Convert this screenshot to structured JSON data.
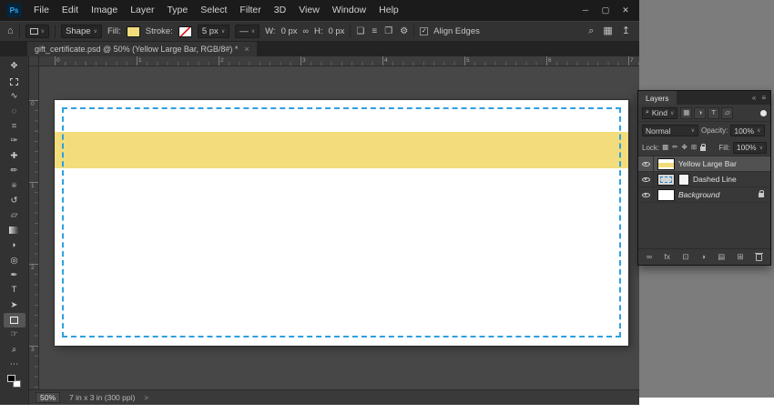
{
  "colors": {
    "fill_yellow": "#f2dc7c",
    "dashed_blue": "#2f9fe0",
    "accent_blue": "#37a7f0"
  },
  "menu_bar": {
    "logo": "Ps",
    "items": [
      "File",
      "Edit",
      "Image",
      "Layer",
      "Type",
      "Select",
      "Filter",
      "3D",
      "View",
      "Window",
      "Help"
    ],
    "window_controls": {
      "minimize": "─",
      "maximize": "▢",
      "close": "✕"
    }
  },
  "options_bar": {
    "home_icon_glyph": "⌂",
    "tool_preset_chevron": "∨",
    "mode_select": {
      "value": "Shape",
      "chevron": "∨"
    },
    "fill": {
      "label": "Fill:"
    },
    "stroke": {
      "label": "Stroke:"
    },
    "stroke_width": {
      "value": "5 px",
      "chevron": "∨"
    },
    "stroke_type": {
      "value": "—",
      "chevron": "∨"
    },
    "dims": {
      "w_label": "W:",
      "w_value": "0 px",
      "link_icon_glyph": "∞",
      "h_label": "H:",
      "h_value": "0 px"
    },
    "ops_icons": [
      {
        "name": "path-operations-icon",
        "glyph": "❏"
      },
      {
        "name": "path-alignment-icon",
        "glyph": "≡"
      },
      {
        "name": "path-arrangement-icon",
        "glyph": "❐"
      },
      {
        "name": "settings-gear-icon",
        "glyph": "⚙"
      }
    ],
    "align_edges": {
      "checkmark": "✓",
      "label": "Align Edges"
    },
    "right_icons": [
      {
        "name": "search-icon",
        "glyph": "⌕"
      },
      {
        "name": "workspace-icon",
        "glyph": "▦"
      },
      {
        "name": "share-icon",
        "glyph": "↥"
      }
    ]
  },
  "document_tab": {
    "title": "gift_certificate.psd @ 50% (Yellow Large Bar, RGB/8#) *",
    "close_glyph": "×"
  },
  "toolbar": {
    "tools": [
      {
        "name": "move-tool",
        "glyph": "✥"
      },
      {
        "name": "rectangular-marquee-tool",
        "shape": "marquee"
      },
      {
        "name": "lasso-tool",
        "glyph": "∿"
      },
      {
        "name": "quick-selection-tool",
        "glyph": "◌"
      },
      {
        "name": "crop-tool",
        "glyph": "⌗"
      },
      {
        "name": "eyedropper-tool",
        "glyph": "✑"
      },
      {
        "name": "healing-brush-tool",
        "glyph": "✚"
      },
      {
        "name": "brush-tool",
        "glyph": "✏"
      },
      {
        "name": "clone-stamp-tool",
        "glyph": "⍟"
      },
      {
        "name": "history-brush-tool",
        "glyph": "↺"
      },
      {
        "name": "eraser-tool",
        "glyph": "▱"
      },
      {
        "name": "gradient-tool",
        "shape": "gradient"
      },
      {
        "name": "blur-tool",
        "glyph": "◗"
      },
      {
        "name": "dodge-tool",
        "glyph": "◎"
      },
      {
        "name": "pen-tool",
        "glyph": "✒"
      },
      {
        "name": "type-tool",
        "glyph": "T"
      },
      {
        "name": "path-selection-tool",
        "glyph": "➤"
      },
      {
        "name": "rectangle-tool",
        "shape": "rect",
        "active": true
      },
      {
        "name": "hand-tool",
        "glyph": "☞"
      },
      {
        "name": "zoom-tool",
        "glyph": "⌕"
      },
      {
        "name": "edit-toolbar-button",
        "glyph": "⋯"
      }
    ]
  },
  "rulers": {
    "horizontal": [
      "0",
      "1",
      "2",
      "3",
      "4",
      "5",
      "6",
      "7"
    ],
    "vertical": [
      "0",
      "1",
      "2",
      "3"
    ]
  },
  "canvas": {
    "yellow_bar_color": "#f2dc7c",
    "dashed_border_color": "#2f9fe0"
  },
  "status_bar": {
    "zoom": "50%",
    "doc_size": "7 in x 3 in (300 ppi)",
    "chevron": ">"
  },
  "layers_panel": {
    "title": "Layers",
    "header_icons": {
      "collapse": "«",
      "menu": "≡"
    },
    "filter": {
      "search_glyph": "⌕",
      "kind_label": "Kind",
      "chevron": "∨",
      "icons": [
        {
          "name": "filter-pixel-layers-icon",
          "glyph": "▦"
        },
        {
          "name": "filter-adjustment-layers-icon",
          "glyph": "◑"
        },
        {
          "name": "filter-type-layers-icon",
          "glyph": "T"
        },
        {
          "name": "filter-shape-layers-icon",
          "glyph": "▱"
        }
      ]
    },
    "blend_mode": {
      "value": "Normal",
      "chevron": "∨"
    },
    "opacity": {
      "label": "Opacity:",
      "value": "100%",
      "chevron": "∨"
    },
    "lock": {
      "label": "Lock:",
      "icons": [
        {
          "name": "lock-transparent-pixels-icon",
          "glyph": "▩"
        },
        {
          "name": "lock-image-pixels-icon",
          "glyph": "✏"
        },
        {
          "name": "lock-position-icon",
          "glyph": "✥"
        },
        {
          "name": "lock-artboard-icon",
          "glyph": "⊞"
        },
        {
          "name": "lock-all-icon",
          "shape": "lock"
        }
      ]
    },
    "fill": {
      "label": "Fill:",
      "value": "100%",
      "chevron": "∨"
    },
    "layers": [
      {
        "name": "Yellow Large Bar",
        "selected": true,
        "thumbs": [
          "yellow"
        ]
      },
      {
        "name": "Dashed Line",
        "selected": false,
        "thumbs": [
          "dashedthumb",
          "mask"
        ]
      },
      {
        "name": "Background",
        "selected": false,
        "italic": true,
        "locked": true,
        "thumbs": [
          "white"
        ]
      }
    ],
    "bottom_icons": [
      {
        "name": "link-layers-icon",
        "glyph": "∞"
      },
      {
        "name": "layer-style-icon",
        "glyph": "fx"
      },
      {
        "name": "add-layer-mask-icon",
        "glyph": "⊡"
      },
      {
        "name": "add-adjustment-layer-icon",
        "glyph": "◑"
      },
      {
        "name": "new-group-icon",
        "glyph": "▤"
      },
      {
        "name": "new-layer-icon",
        "glyph": "⊞"
      },
      {
        "name": "delete-layer-icon",
        "shape": "trash"
      }
    ]
  }
}
